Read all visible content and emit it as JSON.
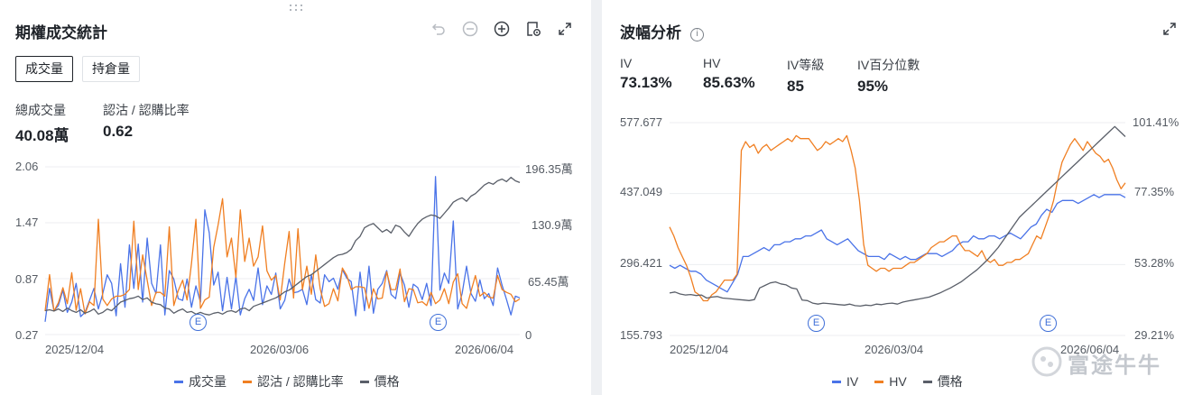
{
  "left_panel": {
    "title": "期權成交統計",
    "tabs": [
      {
        "label": "成交量",
        "active": true
      },
      {
        "label": "持倉量",
        "active": false
      }
    ],
    "stats": [
      {
        "label": "總成交量",
        "value": "40.08萬"
      },
      {
        "label": "認沽 / 認購比率",
        "value": "0.62"
      }
    ],
    "toolbar_icons": [
      "undo-icon",
      "zoom-out-icon",
      "zoom-in-icon",
      "settings-icon",
      "expand-icon"
    ]
  },
  "right_panel": {
    "title": "波幅分析",
    "info_icon": "i",
    "stats": [
      {
        "label": "IV",
        "value": "73.13%"
      },
      {
        "label": "HV",
        "value": "85.63%"
      },
      {
        "label": "IV等級",
        "value": "85"
      },
      {
        "label": "IV百分位數",
        "value": "95%"
      }
    ],
    "toolbar_icons": [
      "expand-icon"
    ]
  },
  "event_marker": "E",
  "watermark": "富途牛牛",
  "chart_data": [
    {
      "type": "line",
      "title": "",
      "x_tick_labels": [
        "2025/12/04",
        "2026/03/06",
        "2026/06/04"
      ],
      "y_left_ticks": [
        "2.06",
        "1.47",
        "0.87",
        "0.27"
      ],
      "y_right_ticks": [
        "196.35萬",
        "130.9萬",
        "65.45萬",
        "0"
      ],
      "ylim_left": [
        0.27,
        2.06
      ],
      "ylim_right": [
        0,
        1963500
      ],
      "legend": "bottom",
      "colors": {
        "成交量": "#4a73e8",
        "認沽 / 認購比率": "#f07f22",
        "價格": "#5a5f69"
      },
      "series": [
        {
          "name": "成交量",
          "axis": "right",
          "values": [
            150000,
            540000,
            280000,
            340000,
            520000,
            260000,
            380000,
            600000,
            210000,
            260000,
            400000,
            540000,
            300000,
            480000,
            700000,
            600000,
            220000,
            830000,
            320000,
            1050000,
            540000,
            1060000,
            380000,
            1130000,
            600000,
            480000,
            1050000,
            230000,
            750000,
            650000,
            420000,
            400000,
            650000,
            320000,
            570000,
            380000,
            1460000,
            1190000,
            580000,
            730000,
            280000,
            670000,
            300000,
            680000,
            230000,
            420000,
            530000,
            400000,
            780000,
            350000,
            570000,
            470000,
            720000,
            300000,
            400000,
            650000,
            490000,
            500000,
            530000,
            350000,
            700000,
            410000,
            370000,
            700000,
            620000,
            660000,
            530000,
            760000,
            660000,
            620000,
            220000,
            730000,
            280000,
            800000,
            250000,
            530000,
            600000,
            750000,
            470000,
            420000,
            720000,
            580000,
            320000,
            590000,
            550000,
            410000,
            600000,
            340000,
            1850000,
            520000,
            720000,
            600000,
            1330000,
            300000,
            480000,
            800000,
            480000,
            390000,
            640000,
            420000,
            480000,
            340000,
            780000,
            580000,
            410000,
            230000,
            450000,
            430000
          ]
        },
        {
          "name": "認沽 / 認購比率",
          "axis": "left",
          "values": [
            0.52,
            0.91,
            0.52,
            0.61,
            0.77,
            0.6,
            0.93,
            0.53,
            0.76,
            0.49,
            0.62,
            0.58,
            1.5,
            0.65,
            0.58,
            0.65,
            0.68,
            0.68,
            0.7,
            0.75,
            1.48,
            0.75,
            1.12,
            0.85,
            0.58,
            0.72,
            0.72,
            0.68,
            1.42,
            0.58,
            0.74,
            0.85,
            0.64,
            1.03,
            1.5,
            0.55,
            0.64,
            0.67,
            1.2,
            1.44,
            1.72,
            1.1,
            1.3,
            0.88,
            1.6,
            1.05,
            1.3,
            1.0,
            1.1,
            1.43,
            0.95,
            0.85,
            0.9,
            0.64,
            1.03,
            1.37,
            0.66,
            1.4,
            0.75,
            1.0,
            0.7,
            1.12,
            0.76,
            0.57,
            0.6,
            0.76,
            0.63,
            0.98,
            0.9,
            0.75,
            0.78,
            0.78,
            0.77,
            0.55,
            0.76,
            0.65,
            0.66,
            0.94,
            0.75,
            0.75,
            0.97,
            0.62,
            0.76,
            0.75,
            0.61,
            0.62,
            0.58,
            0.72,
            0.6,
            0.64,
            0.76,
            0.6,
            0.83,
            0.92,
            0.6,
            0.55,
            0.73,
            0.9,
            0.68,
            0.72,
            0.67,
            0.66,
            0.9,
            0.75,
            0.72,
            0.7,
            0.62,
            0.65
          ]
        },
        {
          "name": "價格",
          "axis": "right",
          "values": [
            280000,
            290000,
            275000,
            300000,
            270000,
            310000,
            280000,
            260000,
            290000,
            250000,
            270000,
            300000,
            240000,
            260000,
            300000,
            280000,
            330000,
            380000,
            400000,
            420000,
            430000,
            450000,
            410000,
            430000,
            380000,
            360000,
            350000,
            310000,
            300000,
            250000,
            280000,
            300000,
            260000,
            270000,
            240000,
            260000,
            240000,
            230000,
            250000,
            260000,
            240000,
            270000,
            280000,
            260000,
            300000,
            310000,
            280000,
            330000,
            350000,
            370000,
            390000,
            410000,
            430000,
            460000,
            500000,
            520000,
            560000,
            600000,
            640000,
            680000,
            700000,
            740000,
            780000,
            820000,
            860000,
            900000,
            930000,
            940000,
            960000,
            1000000,
            1100000,
            1150000,
            1250000,
            1280000,
            1300000,
            1250000,
            1200000,
            1230000,
            1190000,
            1280000,
            1260000,
            1200000,
            1150000,
            1230000,
            1300000,
            1350000,
            1380000,
            1400000,
            1390000,
            1360000,
            1420000,
            1480000,
            1550000,
            1580000,
            1600000,
            1560000,
            1620000,
            1650000,
            1700000,
            1750000,
            1780000,
            1760000,
            1800000,
            1820000,
            1790000,
            1840000,
            1800000,
            1780000
          ]
        }
      ],
      "events": [
        {
          "label": "E",
          "position": 0.33
        },
        {
          "label": "E",
          "position": 0.83
        }
      ]
    },
    {
      "type": "line",
      "title": "",
      "x_tick_labels": [
        "2025/12/04",
        "2026/03/04",
        "2026/06/04"
      ],
      "y_left_ticks": [
        "577.677",
        "437.049",
        "296.421",
        "155.793"
      ],
      "y_right_ticks": [
        "101.41%",
        "77.35%",
        "53.28%",
        "29.21%"
      ],
      "ylim_left": [
        155.793,
        577.677
      ],
      "ylim_right": [
        29.21,
        101.41
      ],
      "legend": "bottom",
      "colors": {
        "IV": "#4a73e8",
        "HV": "#f07f22",
        "價格": "#5a5f69"
      },
      "series": [
        {
          "name": "IV",
          "axis": "right",
          "values": [
            53,
            52,
            53,
            52,
            51,
            51,
            50,
            48,
            47,
            46,
            45,
            44,
            47,
            50,
            56,
            56,
            57,
            58,
            59,
            58,
            60,
            60,
            61,
            61,
            62,
            62,
            63,
            63,
            64,
            65,
            62,
            61,
            60,
            61,
            62,
            60,
            58,
            57,
            56,
            56,
            56,
            55,
            57,
            56,
            55,
            56,
            55,
            55,
            56,
            57,
            57,
            57,
            56,
            57,
            58,
            60,
            61,
            61,
            63,
            62,
            62,
            63,
            63,
            62,
            63,
            64,
            63,
            62,
            64,
            66,
            67,
            70,
            72,
            71,
            74,
            75,
            75,
            75,
            74,
            75,
            76,
            77,
            76,
            77,
            77,
            77,
            77,
            76
          ]
        },
        {
          "name": "HV",
          "axis": "right",
          "values": [
            66,
            63,
            59,
            56,
            53,
            49,
            44,
            43,
            41,
            41,
            43,
            44,
            46,
            48,
            48,
            48,
            50,
            92,
            95,
            93,
            94,
            91,
            93,
            94,
            92,
            93,
            94,
            95,
            96,
            95,
            97,
            96,
            96,
            96,
            94,
            92,
            93,
            95,
            94,
            95,
            96,
            95,
            97,
            92,
            86,
            75,
            60,
            53,
            52,
            51,
            52,
            52,
            51,
            52,
            52,
            52,
            53,
            54,
            54,
            55,
            56,
            57,
            59,
            60,
            61,
            61,
            62,
            63,
            63,
            60,
            58,
            58,
            57,
            56,
            58,
            55,
            54,
            55,
            53,
            53,
            54,
            54,
            55,
            55,
            56,
            57,
            60,
            63,
            62,
            66,
            70,
            75,
            82,
            88,
            91,
            94,
            96,
            94,
            92,
            95,
            93,
            91,
            90,
            88,
            89,
            86,
            82,
            79,
            81
          ]
        },
        {
          "name": "價格",
          "axis": "left",
          "values": [
            240,
            242,
            238,
            236,
            237,
            235,
            236,
            230,
            232,
            233,
            230,
            229,
            228,
            227,
            226,
            225,
            227,
            250,
            255,
            260,
            262,
            258,
            256,
            250,
            248,
            226,
            225,
            220,
            218,
            220,
            219,
            218,
            217,
            216,
            218,
            215,
            214,
            216,
            215,
            218,
            217,
            219,
            220,
            218,
            222,
            224,
            226,
            228,
            230,
            232,
            236,
            240,
            245,
            250,
            256,
            262,
            270,
            278,
            286,
            296,
            306,
            318,
            330,
            345,
            360,
            375,
            390,
            400,
            410,
            420,
            430,
            440,
            450,
            460,
            470,
            480,
            490,
            500,
            510,
            520,
            530,
            540,
            550,
            560,
            570,
            560,
            550
          ]
        }
      ],
      "events": [
        {
          "label": "E",
          "position": 0.31
        },
        {
          "label": "E",
          "position": 0.82
        }
      ]
    }
  ]
}
